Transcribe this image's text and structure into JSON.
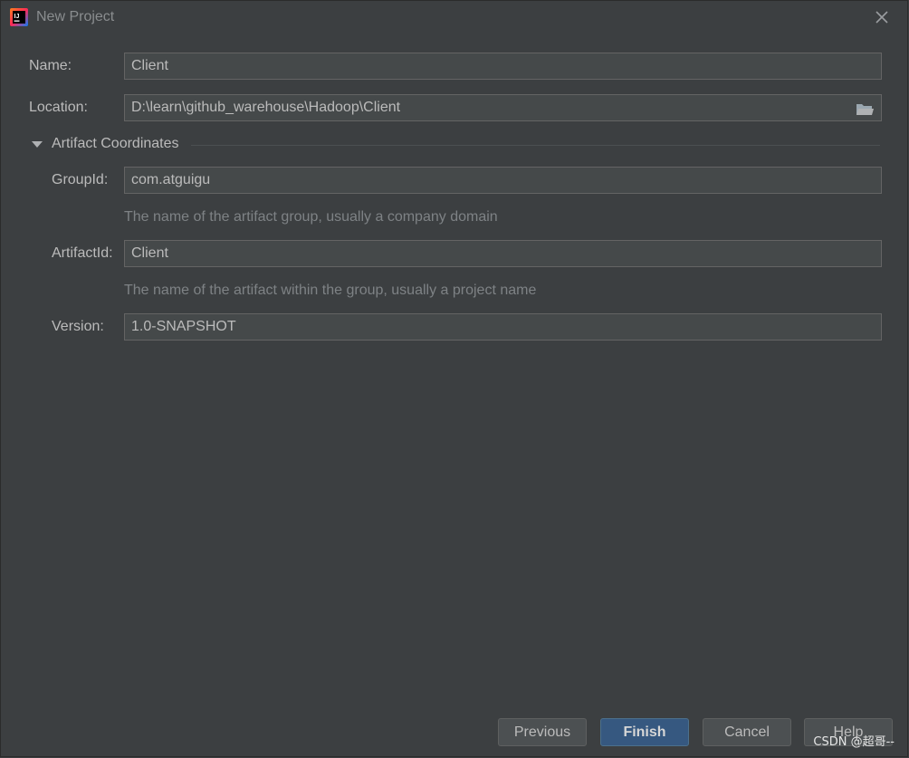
{
  "window": {
    "title": "New Project",
    "icon": "intellij-idea-icon"
  },
  "form": {
    "name_label": "Name:",
    "name_value": "Client",
    "location_label": "Location:",
    "location_value": "D:\\learn\\github_warehouse\\Hadoop\\Client",
    "section_label": "Artifact Coordinates",
    "section_expanded": true,
    "groupid_label": "GroupId:",
    "groupid_value": "com.atguigu",
    "groupid_hint": "The name of the artifact group, usually a company domain",
    "artifactid_label": "ArtifactId:",
    "artifactid_value": "Client",
    "artifactid_hint": "The name of the artifact within the group, usually a project name",
    "version_label": "Version:",
    "version_value": "1.0-SNAPSHOT"
  },
  "buttons": {
    "previous": "Previous",
    "finish": "Finish",
    "cancel": "Cancel",
    "help": "Help"
  },
  "watermark": "CSDN @超哥--",
  "colors": {
    "background": "#3c3f41",
    "field_background": "#45494a",
    "primary_button": "#365880",
    "text": "#bbbbbb",
    "hint_text": "#7e8285"
  }
}
